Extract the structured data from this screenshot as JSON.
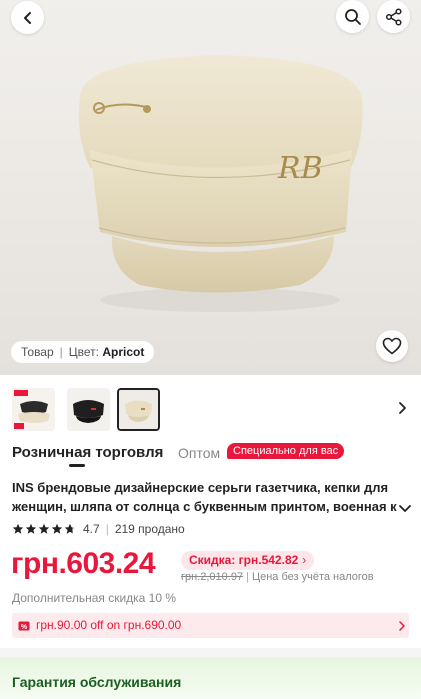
{
  "header": {
    "back_icon": "chevron-left-icon",
    "search_icon": "search-icon",
    "share_icon": "share-icon"
  },
  "product_image": {
    "variant_label": "Товар",
    "color_prefix": "Цвет:",
    "color_value": "Apricot",
    "emblem_text": "RB",
    "favorite_icon": "heart-outline-icon"
  },
  "thumbnails": {
    "count_visible": 3,
    "selected_index": 2,
    "next_icon": "chevron-right-icon"
  },
  "tabs": {
    "retail": "Розничная торговля",
    "wholesale": "Оптом",
    "special_badge": "Специально для вас"
  },
  "product": {
    "title_line1": "INS брендовые дизайнерские серьги газетчика, кепки для",
    "title_line2": "женщин, шляпа от солнца с буквенным принтом, военная к",
    "rating": "4.7",
    "rating_stars": 4.7,
    "sold": "219 продано"
  },
  "pricing": {
    "price": "грн.603.24",
    "discount_chip": "Скидка: грн.542.82",
    "old_price": "грн.2,010.97",
    "tax_note": "Цена без учёта налогов",
    "extra_discount": "Дополнительная скидка 10 %"
  },
  "coupon": {
    "text": "грн.90.00 off on грн.690.00"
  },
  "guarantee": {
    "label": "Гарантия обслуживания"
  },
  "colors": {
    "accent": "#e8173b",
    "accent_light": "#fde6ea",
    "guarantee_text": "#1b5e20",
    "cap": "#e9e0c6"
  }
}
